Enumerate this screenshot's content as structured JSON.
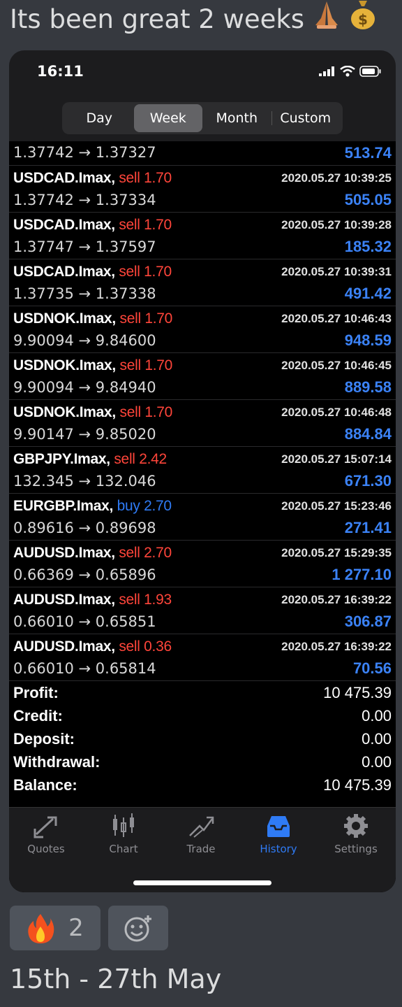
{
  "message": {
    "caption": "Its been great 2 weeks",
    "footer": "15th - 27th May",
    "reaction_count": "2"
  },
  "status_bar": {
    "time": "16:11"
  },
  "period_tabs": [
    {
      "label": "Day",
      "active": false
    },
    {
      "label": "Week",
      "active": true
    },
    {
      "label": "Month",
      "active": false
    },
    {
      "label": "Custom",
      "active": false
    }
  ],
  "partial_row": {
    "prices": "1.37742 → 1.37327",
    "profit": "513.74"
  },
  "trades": [
    {
      "symbol": "USDCAD.Imax,",
      "side": "sell 1.70",
      "date": "2020.05.27 10:39:25",
      "prices": "1.37742 → 1.37334",
      "profit": "505.05"
    },
    {
      "symbol": "USDCAD.Imax,",
      "side": "sell 1.70",
      "date": "2020.05.27 10:39:28",
      "prices": "1.37747 → 1.37597",
      "profit": "185.32"
    },
    {
      "symbol": "USDCAD.Imax,",
      "side": "sell 1.70",
      "date": "2020.05.27 10:39:31",
      "prices": "1.37735 → 1.37338",
      "profit": "491.42"
    },
    {
      "symbol": "USDNOK.Imax,",
      "side": "sell 1.70",
      "date": "2020.05.27 10:46:43",
      "prices": "9.90094 → 9.84600",
      "profit": "948.59"
    },
    {
      "symbol": "USDNOK.Imax,",
      "side": "sell 1.70",
      "date": "2020.05.27 10:46:45",
      "prices": "9.90094 → 9.84940",
      "profit": "889.58"
    },
    {
      "symbol": "USDNOK.Imax,",
      "side": "sell 1.70",
      "date": "2020.05.27 10:46:48",
      "prices": "9.90147 → 9.85020",
      "profit": "884.84"
    },
    {
      "symbol": "GBPJPY.Imax,",
      "side": "sell 2.42",
      "date": "2020.05.27 15:07:14",
      "prices": "132.345 → 132.046",
      "profit": "671.30"
    },
    {
      "symbol": "EURGBP.Imax,",
      "side": "buy 2.70",
      "date": "2020.05.27 15:23:46",
      "prices": "0.89616 → 0.89698",
      "profit": "271.41"
    },
    {
      "symbol": "AUDUSD.Imax,",
      "side": "sell 2.70",
      "date": "2020.05.27 15:29:35",
      "prices": "0.66369 → 0.65896",
      "profit": "1 277.10"
    },
    {
      "symbol": "AUDUSD.Imax,",
      "side": "sell 1.93",
      "date": "2020.05.27 16:39:22",
      "prices": "0.66010 → 0.65851",
      "profit": "306.87"
    },
    {
      "symbol": "AUDUSD.Imax,",
      "side": "sell 0.36",
      "date": "2020.05.27 16:39:22",
      "prices": "0.66010 → 0.65814",
      "profit": "70.56"
    }
  ],
  "summary": [
    {
      "label": "Profit:",
      "value": "10 475.39"
    },
    {
      "label": "Credit:",
      "value": "0.00"
    },
    {
      "label": "Deposit:",
      "value": "0.00"
    },
    {
      "label": "Withdrawal:",
      "value": "0.00"
    },
    {
      "label": "Balance:",
      "value": "10 475.39"
    }
  ],
  "tabbar": [
    {
      "label": "Quotes",
      "icon": "quotes-icon",
      "active": false
    },
    {
      "label": "Chart",
      "icon": "chart-icon",
      "active": false
    },
    {
      "label": "Trade",
      "icon": "trade-icon",
      "active": false
    },
    {
      "label": "History",
      "icon": "history-icon",
      "active": true
    },
    {
      "label": "Settings",
      "icon": "settings-icon",
      "active": false
    }
  ],
  "colors": {
    "sell": "#ff453a",
    "buy": "#2f7bf5",
    "profit": "#3b82f6",
    "active_tab": "#2f7bf5"
  }
}
